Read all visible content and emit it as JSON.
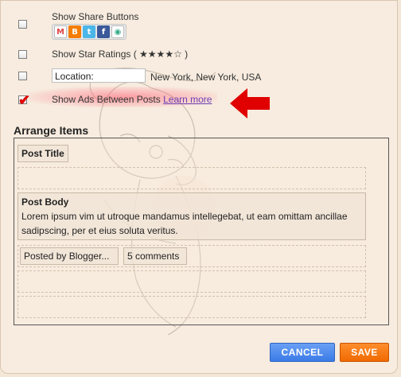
{
  "options": {
    "share": {
      "label": "Show Share Buttons",
      "checked": false,
      "icons": [
        {
          "name": "gmail-icon",
          "glyph": "M"
        },
        {
          "name": "blogger-icon",
          "glyph": "B"
        },
        {
          "name": "twitter-icon",
          "glyph": "t"
        },
        {
          "name": "facebook-icon",
          "glyph": "f"
        },
        {
          "name": "buzz-icon",
          "glyph": "◉"
        }
      ]
    },
    "star": {
      "label": "Show Star Ratings ( ★★★★☆ )",
      "checked": false
    },
    "location": {
      "checked": false,
      "input_value": "Location:",
      "value": "New York, New York, USA"
    },
    "ads": {
      "label": "Show Ads Between Posts",
      "link": "Learn more",
      "checked": true
    }
  },
  "arrange": {
    "title": "Arrange Items",
    "post_title": "Post Title",
    "post_body_label": "Post Body",
    "post_body_text": "Lorem ipsum vim ut utroque mandamus intellegebat, ut eam omittam ancillae sadipscing, per et eius soluta veritus.",
    "posted_by": "Posted by Blogger...",
    "comments": "5 comments"
  },
  "buttons": {
    "cancel": "CANCEL",
    "save": "SAVE"
  },
  "colors": {
    "cancel": "#3b7be6",
    "save": "#f06a00",
    "highlight": "#ff5a6e",
    "arrow": "#e00000"
  }
}
